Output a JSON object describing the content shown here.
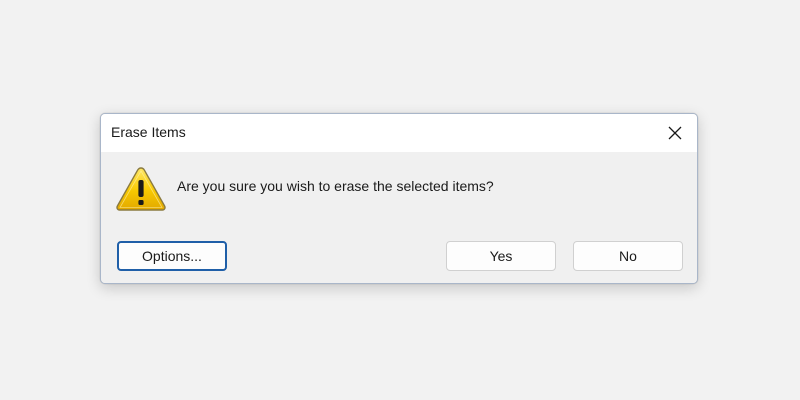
{
  "dialog": {
    "title": "Erase Items",
    "message": "Are you sure you wish to erase the selected items?",
    "icon": "warning-icon",
    "close_icon": "close-icon"
  },
  "buttons": {
    "options_label": "Options...",
    "yes_label": "Yes",
    "no_label": "No"
  },
  "colors": {
    "background": "#f2f2f2",
    "dialog_body": "#f0f0f0",
    "titlebar": "#ffffff",
    "default_button_border": "#1f5fa8",
    "warning_yellow": "#f5c400"
  }
}
